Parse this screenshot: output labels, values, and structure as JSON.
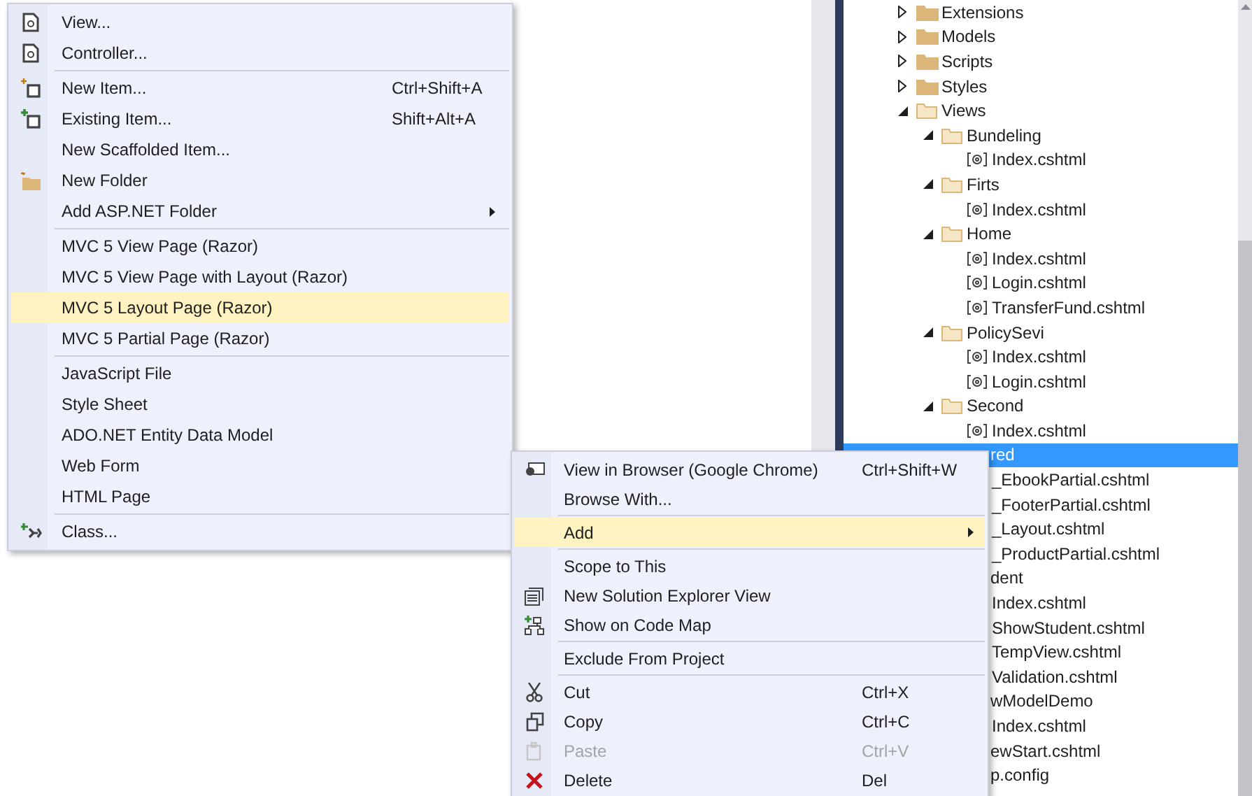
{
  "solution_explorer": {
    "items": [
      {
        "kind": "folder",
        "label": "Extensions",
        "expanded": false,
        "selected": false
      },
      {
        "kind": "folder",
        "label": "Models",
        "expanded": false,
        "selected": false
      },
      {
        "kind": "folder",
        "label": "Scripts",
        "expanded": false,
        "selected": false
      },
      {
        "kind": "folder",
        "label": "Styles",
        "expanded": false,
        "selected": false
      },
      {
        "kind": "folder",
        "label": "Views",
        "expanded": true,
        "selected": false,
        "children": [
          {
            "kind": "folder",
            "label": "Bundeling",
            "expanded": true,
            "selected": false,
            "children": [
              {
                "kind": "file",
                "label": "Index.cshtml",
                "selected": false
              }
            ]
          },
          {
            "kind": "folder",
            "label": "Firts",
            "expanded": true,
            "selected": false,
            "children": [
              {
                "kind": "file",
                "label": "Index.cshtml",
                "selected": false
              }
            ]
          },
          {
            "kind": "folder",
            "label": "Home",
            "expanded": true,
            "selected": false,
            "children": [
              {
                "kind": "file",
                "label": "Index.cshtml",
                "selected": false
              },
              {
                "kind": "file",
                "label": "Login.cshtml",
                "selected": false
              },
              {
                "kind": "file",
                "label": "TransferFund.cshtml",
                "selected": false
              }
            ]
          },
          {
            "kind": "folder",
            "label": "PolicySevi",
            "expanded": true,
            "selected": false,
            "children": [
              {
                "kind": "file",
                "label": "Index.cshtml",
                "selected": false
              },
              {
                "kind": "file",
                "label": "Login.cshtml",
                "selected": false
              }
            ]
          },
          {
            "kind": "folder",
            "label": "Second",
            "expanded": true,
            "selected": false,
            "children": [
              {
                "kind": "file",
                "label": "Index.cshtml",
                "selected": false
              }
            ]
          },
          {
            "kind": "folder",
            "label": "red",
            "selected": true,
            "children": [
              {
                "kind": "file",
                "label": "_EbookPartial.cshtml",
                "selected": false
              },
              {
                "kind": "file",
                "label": "_FooterPartial.cshtml",
                "selected": false
              },
              {
                "kind": "file",
                "label": "_Layout.cshtml",
                "selected": false
              },
              {
                "kind": "file",
                "label": "_ProductPartial.cshtml",
                "selected": false
              }
            ]
          },
          {
            "kind": "folder",
            "label": "dent",
            "selected": false,
            "children": [
              {
                "kind": "file",
                "label": "Index.cshtml",
                "selected": false
              },
              {
                "kind": "file",
                "label": "ShowStudent.cshtml",
                "selected": false
              },
              {
                "kind": "file",
                "label": "TempView.cshtml",
                "selected": false
              },
              {
                "kind": "file",
                "label": "Validation.cshtml",
                "selected": false
              }
            ]
          },
          {
            "kind": "folder",
            "label": "wModelDemo",
            "selected": false,
            "children": [
              {
                "kind": "file",
                "label": "Index.cshtml",
                "selected": false
              }
            ]
          },
          {
            "kind": "file",
            "label": "ewStart.cshtml",
            "selected": false
          }
        ]
      },
      {
        "kind": "file",
        "label": "p.config",
        "selected": false
      }
    ]
  },
  "add_menu": {
    "items": [
      {
        "kind": "item",
        "label": "View...",
        "selected": false
      },
      {
        "kind": "item",
        "label": "Controller...",
        "selected": false
      },
      {
        "kind": "separator"
      },
      {
        "kind": "item",
        "label": "New Item...",
        "shortcut": "Ctrl+Shift+A",
        "selected": false
      },
      {
        "kind": "item",
        "label": "Existing Item...",
        "shortcut": "Shift+Alt+A",
        "selected": false
      },
      {
        "kind": "item",
        "label": "New Scaffolded Item...",
        "selected": false
      },
      {
        "kind": "item",
        "label": "New Folder",
        "selected": false
      },
      {
        "kind": "item",
        "label": "Add ASP.NET Folder",
        "submenu": true,
        "selected": false
      },
      {
        "kind": "separator"
      },
      {
        "kind": "item",
        "label": "MVC 5 View Page (Razor)",
        "selected": false
      },
      {
        "kind": "item",
        "label": "MVC 5 View Page with Layout (Razor)",
        "selected": false
      },
      {
        "kind": "item",
        "label": "MVC 5 Layout Page (Razor)",
        "selected": true
      },
      {
        "kind": "item",
        "label": "MVC 5 Partial Page (Razor)",
        "selected": false
      },
      {
        "kind": "separator"
      },
      {
        "kind": "item",
        "label": "JavaScript File",
        "selected": false
      },
      {
        "kind": "item",
        "label": "Style Sheet",
        "selected": false
      },
      {
        "kind": "item",
        "label": "ADO.NET Entity Data Model",
        "selected": false
      },
      {
        "kind": "item",
        "label": "Web Form",
        "selected": false
      },
      {
        "kind": "item",
        "label": "HTML Page",
        "selected": false
      },
      {
        "kind": "separator"
      },
      {
        "kind": "item",
        "label": "Class...",
        "selected": false
      }
    ]
  },
  "context_menu": {
    "items": [
      {
        "kind": "item",
        "label": "View in Browser (Google Chrome)",
        "shortcut": "Ctrl+Shift+W",
        "selected": false,
        "disabled": false
      },
      {
        "kind": "item",
        "label": "Browse With...",
        "selected": false,
        "disabled": false
      },
      {
        "kind": "separator"
      },
      {
        "kind": "item",
        "label": "Add",
        "submenu": true,
        "selected": true,
        "disabled": false
      },
      {
        "kind": "separator"
      },
      {
        "kind": "item",
        "label": "Scope to This",
        "selected": false,
        "disabled": false
      },
      {
        "kind": "item",
        "label": "New Solution Explorer View",
        "selected": false,
        "disabled": false
      },
      {
        "kind": "item",
        "label": "Show on Code Map",
        "selected": false,
        "disabled": false
      },
      {
        "kind": "separator"
      },
      {
        "kind": "item",
        "label": "Exclude From Project",
        "selected": false,
        "disabled": false
      },
      {
        "kind": "separator"
      },
      {
        "kind": "item",
        "label": "Cut",
        "shortcut": "Ctrl+X",
        "selected": false,
        "disabled": false
      },
      {
        "kind": "item",
        "label": "Copy",
        "shortcut": "Ctrl+C",
        "selected": false,
        "disabled": false
      },
      {
        "kind": "item",
        "label": "Paste",
        "shortcut": "Ctrl+V",
        "selected": false,
        "disabled": true
      },
      {
        "kind": "item",
        "label": "Delete",
        "shortcut": "Del",
        "selected": false,
        "disabled": false
      }
    ]
  }
}
